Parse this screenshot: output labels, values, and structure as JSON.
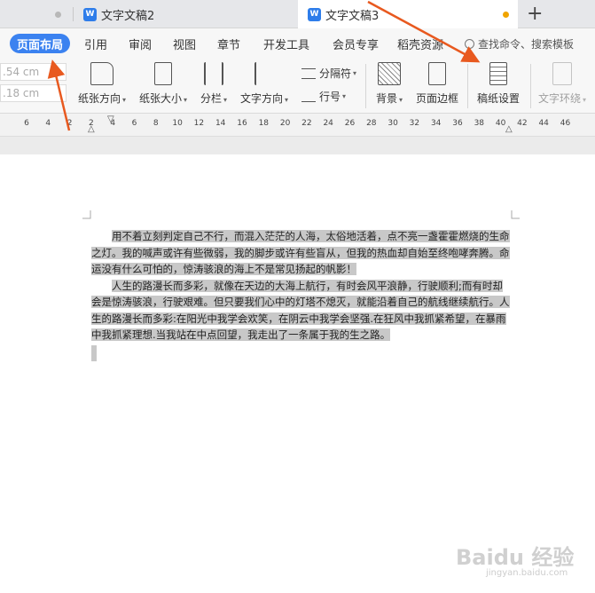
{
  "tabs": [
    {
      "title": "文字文稿2",
      "active": false
    },
    {
      "title": "文字文稿3",
      "active": true
    }
  ],
  "menu": {
    "items": [
      "页面布局",
      "引用",
      "审阅",
      "视图",
      "章节",
      "开发工具",
      "会员专享",
      "稻壳资源"
    ],
    "active": "页面布局",
    "search_placeholder": "查找命令、搜索模板"
  },
  "ribbon": {
    "margin_top": ".54 cm",
    "margin_bottom": ".18 cm",
    "paper_direction": "纸张方向",
    "paper_size": "纸张大小",
    "columns": "分栏",
    "text_direction": "文字方向",
    "separator": "分隔符",
    "line_number": "行号",
    "background": "背景",
    "page_border": "页面边框",
    "manuscript_settings": "稿纸设置",
    "text_wrap": "文字环绕"
  },
  "ruler": {
    "ticks": [
      "6",
      "4",
      "2",
      "2",
      "4",
      "6",
      "8",
      "10",
      "12",
      "14",
      "16",
      "18",
      "20",
      "22",
      "24",
      "26",
      "28",
      "30",
      "32",
      "34",
      "36",
      "38",
      "40",
      "42",
      "44",
      "46"
    ]
  },
  "document": {
    "paragraphs": [
      "用不着立刻判定自己不行，而混入茫茫的人海，太俗地活着，点不亮一盏霍霍燃烧的生命之灯。我的喊声或许有些微弱，我的脚步或许有些盲从，但我的热血却自始至终咆哮奔腾。命运没有什么可怕的，惊涛骇浪的海上不是常见扬起的帆影！",
      "人生的路漫长而多彩，就像在天边的大海上航行，有时会风平浪静，行驶顺利;而有时却会是惊涛骇浪，行驶艰难。但只要我们心中的灯塔不熄灭，就能沿着自己的航线继续航行。人生的路漫长而多彩:在阳光中我学会欢笑，在阴云中我学会坚强.在狂风中我抓紧希望，在暴雨中我抓紧理想.当我站在中点回望，我走出了一条属于我的生之路。"
    ]
  },
  "watermark": {
    "text": "Baidu 经验",
    "sub": "jingyan.baidu.com"
  },
  "colors": {
    "accent": "#3b82f0",
    "annotation_arrow": "#e8591f",
    "selection": "#c8c8c8",
    "unsaved_dot": "#f0a400"
  }
}
